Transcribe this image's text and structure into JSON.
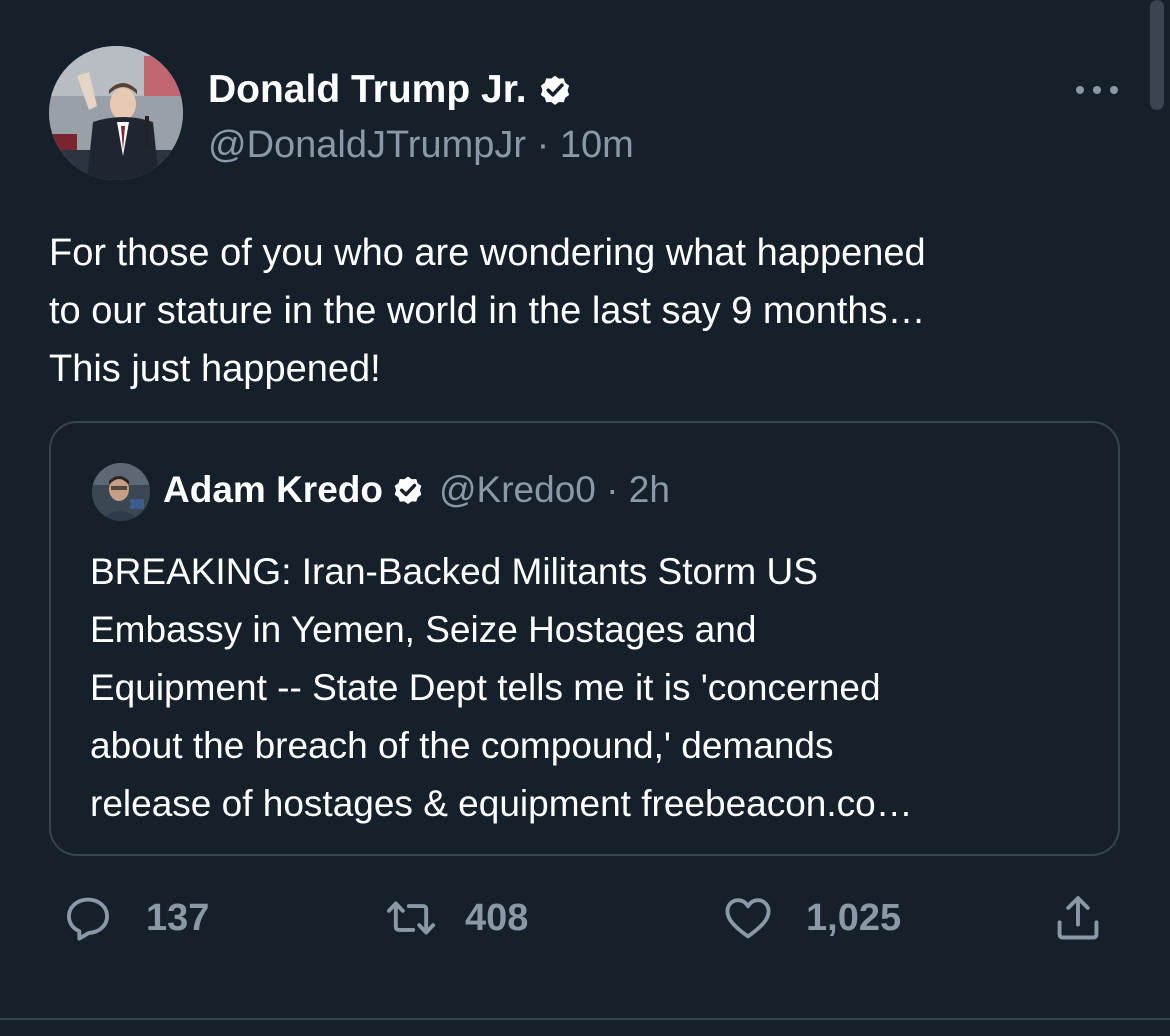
{
  "author": {
    "name": "Donald Trump Jr.",
    "handle": "@DonaldJTrumpJr",
    "time": "10m",
    "verified": true
  },
  "tweet": {
    "lines": [
      "For those of you who are wondering what happened",
      "to our stature in the world in the last say 9 months…",
      "This just happened!"
    ]
  },
  "quoted": {
    "name": "Adam Kredo",
    "handle": "@Kredo0",
    "time": "2h",
    "verified": true,
    "lines": [
      "BREAKING: Iran-Backed Militants Storm US",
      "Embassy in Yemen, Seize Hostages and",
      "Equipment -- State Dept tells me it is 'concerned",
      "about the breach of the compound,' demands",
      "release of hostages & equipment freebeacon.co…"
    ]
  },
  "actions": {
    "reply_count": "137",
    "retweet_count": "408",
    "like_count": "1,025"
  },
  "icons": {
    "more": "more-horizontal-icon",
    "verified": "verified-badge-icon",
    "reply": "reply-icon",
    "retweet": "retweet-icon",
    "like": "heart-icon",
    "share": "share-icon"
  },
  "colors": {
    "background": "#15202b",
    "text": "#ffffff",
    "secondary_text": "#8b98a5",
    "border": "#38444d"
  }
}
